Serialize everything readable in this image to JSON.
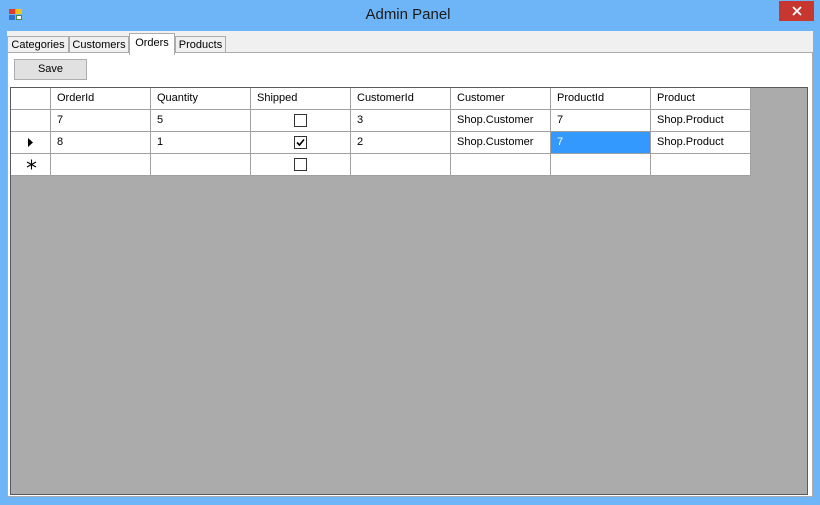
{
  "window": {
    "title": "Admin Panel"
  },
  "tabs": [
    {
      "label": "Categories"
    },
    {
      "label": "Customers"
    },
    {
      "label": "Orders"
    },
    {
      "label": "Products"
    }
  ],
  "active_tab": "Orders",
  "toolbar": {
    "save_label": "Save"
  },
  "grid": {
    "columns": [
      "OrderId",
      "Quantity",
      "Shipped",
      "CustomerId",
      "Customer",
      "ProductId",
      "Product"
    ],
    "rows": [
      {
        "OrderId": "7",
        "Quantity": "5",
        "Shipped": false,
        "CustomerId": "3",
        "Customer": "Shop.Customer",
        "ProductId": "7",
        "Product": "Shop.Product"
      },
      {
        "OrderId": "8",
        "Quantity": "1",
        "Shipped": true,
        "CustomerId": "2",
        "Customer": "Shop.Customer",
        "ProductId": "7",
        "Product": "Shop.Product"
      }
    ],
    "new_row": {
      "Shipped": false
    },
    "current_row_index": 1,
    "selected_cell": {
      "row": 1,
      "column": "ProductId"
    }
  },
  "colors": {
    "title_bar": "#6db5f6",
    "close_button": "#c7372f",
    "selection": "#3399ff",
    "grid_background": "#ababab"
  }
}
